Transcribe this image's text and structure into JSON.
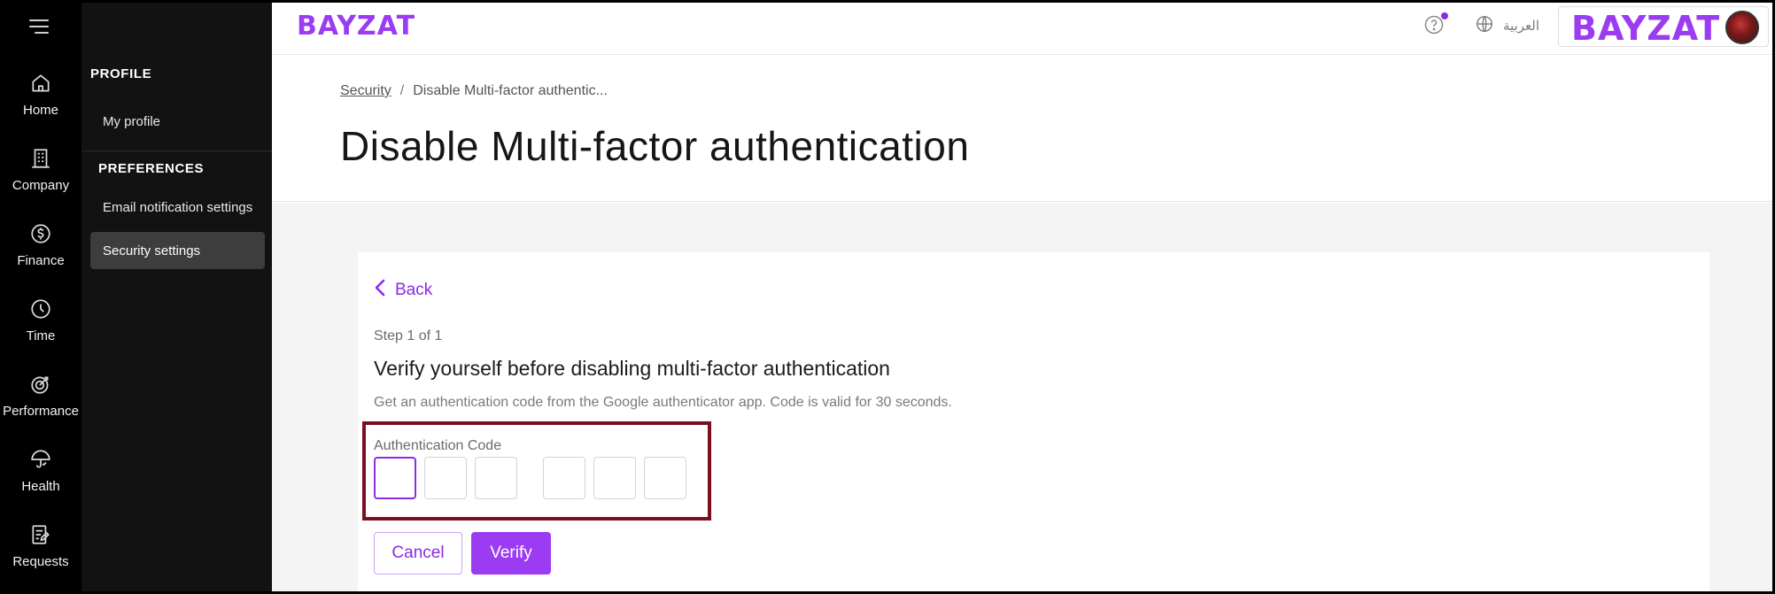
{
  "brand": {
    "logo_text": "BAYZAT",
    "accent": "#9b3bf2"
  },
  "rail": {
    "menu_icon": "hamburger-icon",
    "items": [
      {
        "label": "Home",
        "icon": "home-icon"
      },
      {
        "label": "Company",
        "icon": "building-icon"
      },
      {
        "label": "Finance",
        "icon": "dollar-circle-icon"
      },
      {
        "label": "Time",
        "icon": "clock-icon"
      },
      {
        "label": "Performance",
        "icon": "target-icon"
      },
      {
        "label": "Health",
        "icon": "umbrella-icon"
      },
      {
        "label": "Requests",
        "icon": "request-form-icon"
      }
    ]
  },
  "sidebar": {
    "profile_title": "PROFILE",
    "my_profile": "My profile",
    "preferences_title": "PREFERENCES",
    "email_settings": "Email notification settings",
    "security_settings": "Security settings"
  },
  "topbar": {
    "help_icon": "help-circle-icon",
    "language_icon": "globe-icon",
    "language_label": "العربية",
    "company_logo": "BAYZAT"
  },
  "header": {
    "breadcrumb_link": "Security",
    "breadcrumb_separator": "/",
    "breadcrumb_current": "Disable Multi-factor authentic...",
    "title": "Disable Multi-factor authentication"
  },
  "card": {
    "back_label": "Back",
    "step": "Step 1 of 1",
    "title": "Verify yourself before disabling multi-factor authentication",
    "description": "Get an authentication code from the Google authenticator app. Code is valid for 30 seconds.",
    "code_label": "Authentication Code",
    "cancel_label": "Cancel",
    "verify_label": "Verify"
  }
}
